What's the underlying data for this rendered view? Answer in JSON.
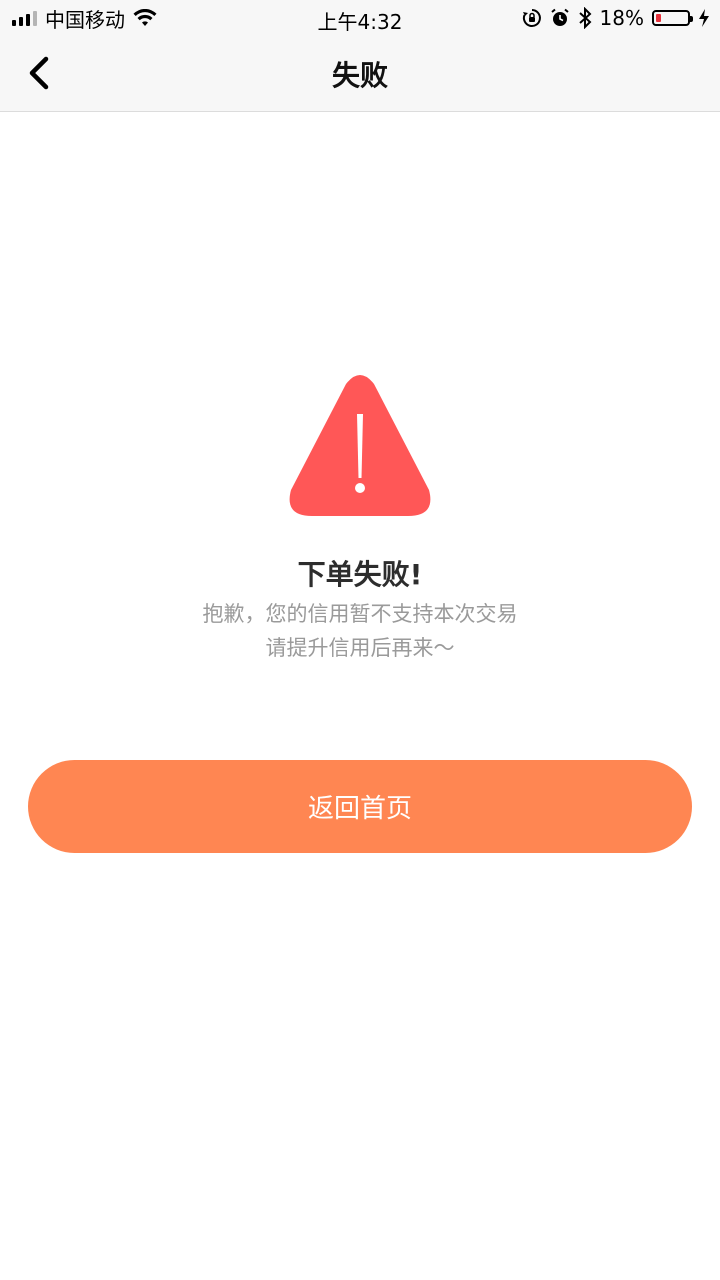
{
  "status_bar": {
    "carrier": "中国移动",
    "time": "上午4:32",
    "battery_percent": "18%",
    "battery_level": 0.18,
    "icons": [
      "signal-icon",
      "wifi-icon",
      "orientation-lock-icon",
      "alarm-icon",
      "bluetooth-icon",
      "battery-icon",
      "charging-icon"
    ]
  },
  "nav": {
    "title": "失败",
    "back_icon": "chevron-left-icon"
  },
  "result": {
    "icon": "warning-triangle-icon",
    "icon_color": "#ff5757",
    "title": "下单失败!",
    "message_line1": "抱歉，您的信用暂不支持本次交易",
    "message_line2": "请提升信用后再来～"
  },
  "actions": {
    "home_button_label": "返回首页",
    "home_button_color": "#ff8652"
  }
}
